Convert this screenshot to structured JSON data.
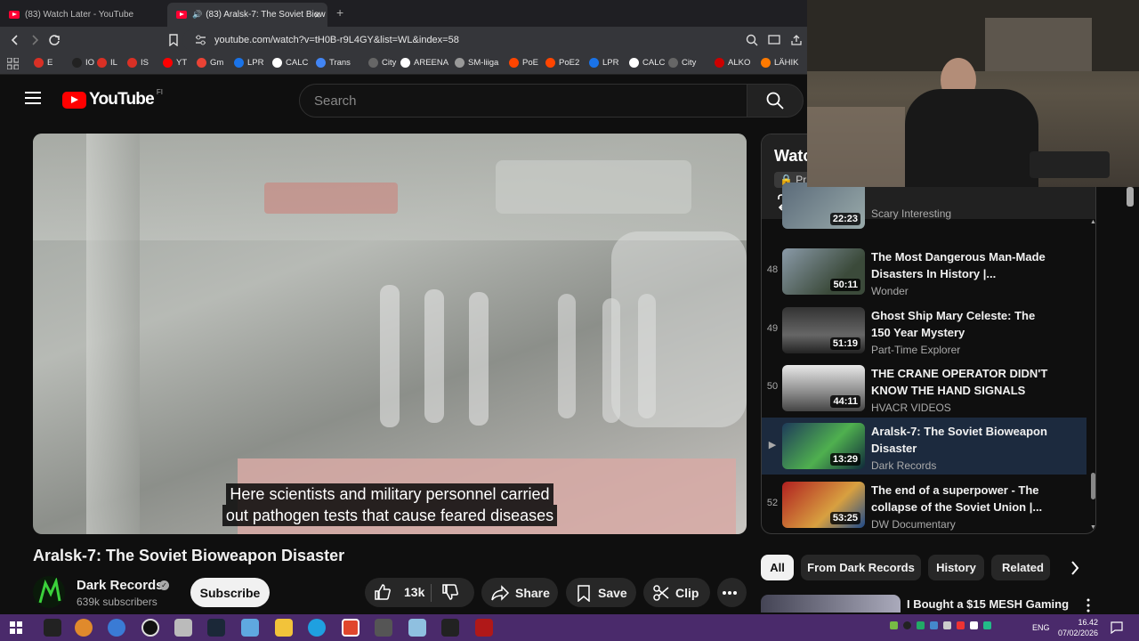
{
  "browser": {
    "tabs": [
      {
        "label": "(83) Watch Later - YouTube"
      },
      {
        "label": "(83) Aralsk-7: The Soviet Biow",
        "close": "×"
      }
    ],
    "new_tab": "+",
    "url": "youtube.com/watch?v=tH0B-r9L4GY&list=WL&index=58",
    "bookmarks": [
      {
        "label": "E",
        "color": "#d93025"
      },
      {
        "label": "IO",
        "color": "#222222"
      },
      {
        "label": "IL",
        "color": "#d93025"
      },
      {
        "label": "IS",
        "color": "#d93025"
      },
      {
        "label": "YT",
        "color": "#ff0000"
      },
      {
        "label": "Gm",
        "color": "#ea4335"
      },
      {
        "label": "LPR",
        "color": "#1a73e8"
      },
      {
        "label": "CALC",
        "color": "#ffffff"
      },
      {
        "label": "Trans",
        "color": "#4285f4"
      },
      {
        "label": "City",
        "color": "#666666"
      },
      {
        "label": "AREENA",
        "color": "#ffffff"
      },
      {
        "label": "SM-liiga",
        "color": "#999999"
      },
      {
        "label": "PoE",
        "color": "#ff4500"
      },
      {
        "label": "PoE2",
        "color": "#ff4500"
      },
      {
        "label": "LPR",
        "color": "#1a73e8"
      },
      {
        "label": "CALC",
        "color": "#ffffff"
      },
      {
        "label": "City",
        "color": "#666666"
      },
      {
        "label": "ALKO",
        "color": "#cc0000"
      },
      {
        "label": "LÄHIK",
        "color": "#ff7a00"
      }
    ]
  },
  "header": {
    "logo": "YouTube",
    "country": "FI",
    "search_placeholder": "Search"
  },
  "video": {
    "subtitle_line1": "Here scientists and military personnel carried",
    "subtitle_line2": "out pathogen tests that cause feared diseases",
    "title": "Aralsk-7: The Soviet Bioweapon Disaster"
  },
  "owner": {
    "channel": "Dark Records",
    "subscribers": "639k subscribers",
    "subscribe_label": "Subscribe"
  },
  "actions": {
    "likes": "13k",
    "share": "Share",
    "save": "Save",
    "clip": "Clip"
  },
  "playlist": {
    "title": "Watc",
    "privacy": "Pri",
    "items": [
      {
        "num": "",
        "duration": "22:23",
        "title": "",
        "channel": "Scary Interesting"
      },
      {
        "num": "48",
        "duration": "50:11",
        "title": "The Most Dangerous Man-Made Disasters In History |...",
        "channel": "Wonder"
      },
      {
        "num": "49",
        "duration": "51:19",
        "title": "Ghost Ship Mary Celeste: The 150 Year Mystery",
        "channel": "Part-Time Explorer"
      },
      {
        "num": "50",
        "duration": "44:11",
        "title": "THE CRANE OPERATOR DIDN'T KNOW THE HAND SIGNALS",
        "channel": "HVACR VIDEOS"
      },
      {
        "num": "▶",
        "duration": "13:29",
        "title": "Aralsk-7: The Soviet Bioweapon Disaster",
        "channel": "Dark Records"
      },
      {
        "num": "52",
        "duration": "53:25",
        "title": "The end of a superpower - The collapse of the Soviet Union |...",
        "channel": "DW Documentary"
      }
    ]
  },
  "chips": [
    "All",
    "From Dark Records",
    "History",
    "Related"
  ],
  "recommendation": {
    "title": "I Bought a $15 MESH Gaming"
  },
  "taskbar": {
    "language": "ENG",
    "time": "16.42",
    "date": "07/02/2026"
  }
}
